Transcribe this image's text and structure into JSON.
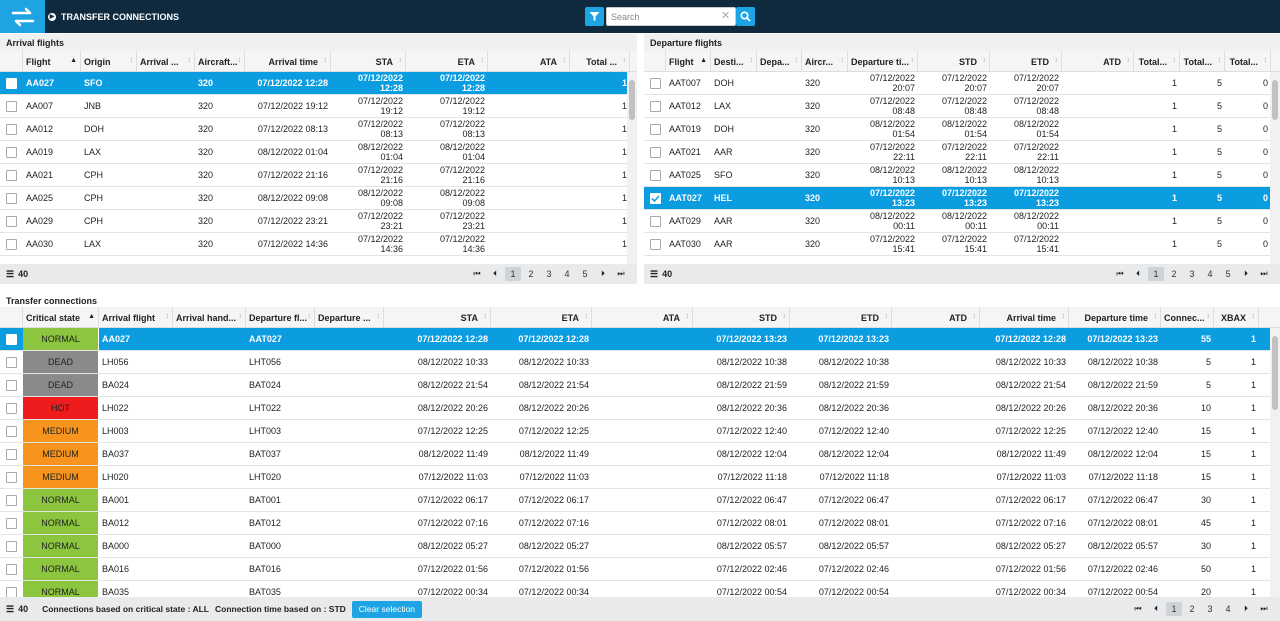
{
  "app": {
    "title": "TRANSFER CONNECTIONS",
    "search_placeholder": "Search",
    "search_value": "",
    "logo_icon": "swap-arrows-icon",
    "accent": "#0c9de1"
  },
  "arrivals": {
    "title": "Arrival flights",
    "columns": [
      "Flight",
      "Origin",
      "Arrival ...",
      "Aircraft...",
      "Arrival time",
      "STA",
      "ETA",
      "ATA",
      "Total ..."
    ],
    "rows": [
      {
        "selected": true,
        "flight": "AA027",
        "origin": "SFO",
        "handler": "",
        "aircraft": "320",
        "arrival": "07/12/2022 12:28",
        "sta": [
          "07/12/2022",
          "12:28"
        ],
        "eta": [
          "07/12/2022",
          "12:28"
        ],
        "ata": "",
        "total": "1"
      },
      {
        "selected": false,
        "flight": "AA007",
        "origin": "JNB",
        "handler": "",
        "aircraft": "320",
        "arrival": "07/12/2022 19:12",
        "sta": [
          "07/12/2022",
          "19:12"
        ],
        "eta": [
          "07/12/2022",
          "19:12"
        ],
        "ata": "",
        "total": "1"
      },
      {
        "selected": false,
        "flight": "AA012",
        "origin": "DOH",
        "handler": "",
        "aircraft": "320",
        "arrival": "07/12/2022 08:13",
        "sta": [
          "07/12/2022",
          "08:13"
        ],
        "eta": [
          "07/12/2022",
          "08:13"
        ],
        "ata": "",
        "total": "1"
      },
      {
        "selected": false,
        "flight": "AA019",
        "origin": "LAX",
        "handler": "",
        "aircraft": "320",
        "arrival": "08/12/2022 01:04",
        "sta": [
          "08/12/2022",
          "01:04"
        ],
        "eta": [
          "08/12/2022",
          "01:04"
        ],
        "ata": "",
        "total": "1"
      },
      {
        "selected": false,
        "flight": "AA021",
        "origin": "CPH",
        "handler": "",
        "aircraft": "320",
        "arrival": "07/12/2022 21:16",
        "sta": [
          "07/12/2022",
          "21:16"
        ],
        "eta": [
          "07/12/2022",
          "21:16"
        ],
        "ata": "",
        "total": "1"
      },
      {
        "selected": false,
        "flight": "AA025",
        "origin": "CPH",
        "handler": "",
        "aircraft": "320",
        "arrival": "08/12/2022 09:08",
        "sta": [
          "08/12/2022",
          "09:08"
        ],
        "eta": [
          "08/12/2022",
          "09:08"
        ],
        "ata": "",
        "total": "1"
      },
      {
        "selected": false,
        "flight": "AA029",
        "origin": "CPH",
        "handler": "",
        "aircraft": "320",
        "arrival": "07/12/2022 23:21",
        "sta": [
          "07/12/2022",
          "23:21"
        ],
        "eta": [
          "07/12/2022",
          "23:21"
        ],
        "ata": "",
        "total": "1"
      },
      {
        "selected": false,
        "flight": "AA030",
        "origin": "LAX",
        "handler": "",
        "aircraft": "320",
        "arrival": "07/12/2022 14:36",
        "sta": [
          "07/12/2022",
          "14:36"
        ],
        "eta": [
          "07/12/2022",
          "14:36"
        ],
        "ata": "",
        "total": "1"
      }
    ],
    "count": "40",
    "pages": [
      "1",
      "2",
      "3",
      "4",
      "5"
    ]
  },
  "departures": {
    "title": "Departure flights",
    "columns": [
      "Flight",
      "Desti...",
      "Depa...",
      "Aircr...",
      "Departure ti...",
      "STD",
      "ETD",
      "ATD",
      "Total...",
      "Total...",
      "Total..."
    ],
    "rows": [
      {
        "selected": false,
        "flight": "AAT007",
        "dest": "DOH",
        "handler": "",
        "aircraft": "320",
        "dep": [
          "07/12/2022",
          "20:07"
        ],
        "std": [
          "07/12/2022",
          "20:07"
        ],
        "etd": [
          "07/12/2022",
          "20:07"
        ],
        "atd": "",
        "t1": "1",
        "t2": "5",
        "t3": "0"
      },
      {
        "selected": false,
        "flight": "AAT012",
        "dest": "LAX",
        "handler": "",
        "aircraft": "320",
        "dep": [
          "07/12/2022",
          "08:48"
        ],
        "std": [
          "07/12/2022",
          "08:48"
        ],
        "etd": [
          "07/12/2022",
          "08:48"
        ],
        "atd": "",
        "t1": "1",
        "t2": "5",
        "t3": "0"
      },
      {
        "selected": false,
        "flight": "AAT019",
        "dest": "DOH",
        "handler": "",
        "aircraft": "320",
        "dep": [
          "08/12/2022",
          "01:54"
        ],
        "std": [
          "08/12/2022",
          "01:54"
        ],
        "etd": [
          "08/12/2022",
          "01:54"
        ],
        "atd": "",
        "t1": "1",
        "t2": "5",
        "t3": "0"
      },
      {
        "selected": false,
        "flight": "AAT021",
        "dest": "AAR",
        "handler": "",
        "aircraft": "320",
        "dep": [
          "07/12/2022",
          "22:11"
        ],
        "std": [
          "07/12/2022",
          "22:11"
        ],
        "etd": [
          "07/12/2022",
          "22:11"
        ],
        "atd": "",
        "t1": "1",
        "t2": "5",
        "t3": "0"
      },
      {
        "selected": false,
        "flight": "AAT025",
        "dest": "SFO",
        "handler": "",
        "aircraft": "320",
        "dep": [
          "08/12/2022",
          "10:13"
        ],
        "std": [
          "08/12/2022",
          "10:13"
        ],
        "etd": [
          "08/12/2022",
          "10:13"
        ],
        "atd": "",
        "t1": "1",
        "t2": "5",
        "t3": "0"
      },
      {
        "selected": true,
        "flight": "AAT027",
        "dest": "HEL",
        "handler": "",
        "aircraft": "320",
        "dep": [
          "07/12/2022",
          "13:23"
        ],
        "std": [
          "07/12/2022",
          "13:23"
        ],
        "etd": [
          "07/12/2022",
          "13:23"
        ],
        "atd": "",
        "t1": "1",
        "t2": "5",
        "t3": "0"
      },
      {
        "selected": false,
        "flight": "AAT029",
        "dest": "AAR",
        "handler": "",
        "aircraft": "320",
        "dep": [
          "08/12/2022",
          "00:11"
        ],
        "std": [
          "08/12/2022",
          "00:11"
        ],
        "etd": [
          "08/12/2022",
          "00:11"
        ],
        "atd": "",
        "t1": "1",
        "t2": "5",
        "t3": "0"
      },
      {
        "selected": false,
        "flight": "AAT030",
        "dest": "AAR",
        "handler": "",
        "aircraft": "320",
        "dep": [
          "07/12/2022",
          "15:41"
        ],
        "std": [
          "07/12/2022",
          "15:41"
        ],
        "etd": [
          "07/12/2022",
          "15:41"
        ],
        "atd": "",
        "t1": "1",
        "t2": "5",
        "t3": "0"
      }
    ],
    "count": "40",
    "pages": [
      "1",
      "2",
      "3",
      "4",
      "5"
    ]
  },
  "transfers": {
    "title": "Transfer connections",
    "columns": [
      "Critical state",
      "Arrival flight",
      "Arrival hand...",
      "Departure fl...",
      "Departure ...",
      "STA",
      "ETA",
      "ATA",
      "STD",
      "ETD",
      "ATD",
      "Arrival time",
      "Departure time",
      "Connec...",
      "XBAX"
    ],
    "state_colors": {
      "NORMAL": "#8cc63f",
      "DEAD": "#8a8a8a",
      "HOT": "#ee1c1c",
      "MEDIUM": "#f7941d"
    },
    "rows": [
      {
        "selected": true,
        "state": "NORMAL",
        "arr": "AA027",
        "arrh": "",
        "dep": "AAT027",
        "deph": "",
        "sta": "07/12/2022 12:28",
        "eta": "07/12/2022 12:28",
        "ata": "",
        "std": "07/12/2022 13:23",
        "etd": "07/12/2022 13:23",
        "atd": "",
        "arrt": "07/12/2022 12:28",
        "dept": "07/12/2022 13:23",
        "conn": "55",
        "xbax": "1"
      },
      {
        "selected": false,
        "state": "DEAD",
        "arr": "LH056",
        "arrh": "",
        "dep": "LHT056",
        "deph": "",
        "sta": "08/12/2022 10:33",
        "eta": "08/12/2022 10:33",
        "ata": "",
        "std": "08/12/2022 10:38",
        "etd": "08/12/2022 10:38",
        "atd": "",
        "arrt": "08/12/2022 10:33",
        "dept": "08/12/2022 10:38",
        "conn": "5",
        "xbax": "1"
      },
      {
        "selected": false,
        "state": "DEAD",
        "arr": "BA024",
        "arrh": "",
        "dep": "BAT024",
        "deph": "",
        "sta": "08/12/2022 21:54",
        "eta": "08/12/2022 21:54",
        "ata": "",
        "std": "08/12/2022 21:59",
        "etd": "08/12/2022 21:59",
        "atd": "",
        "arrt": "08/12/2022 21:54",
        "dept": "08/12/2022 21:59",
        "conn": "5",
        "xbax": "1"
      },
      {
        "selected": false,
        "state": "HOT",
        "arr": "LH022",
        "arrh": "",
        "dep": "LHT022",
        "deph": "",
        "sta": "08/12/2022 20:26",
        "eta": "08/12/2022 20:26",
        "ata": "",
        "std": "08/12/2022 20:36",
        "etd": "08/12/2022 20:36",
        "atd": "",
        "arrt": "08/12/2022 20:26",
        "dept": "08/12/2022 20:36",
        "conn": "10",
        "xbax": "1"
      },
      {
        "selected": false,
        "state": "MEDIUM",
        "arr": "LH003",
        "arrh": "",
        "dep": "LHT003",
        "deph": "",
        "sta": "07/12/2022 12:25",
        "eta": "07/12/2022 12:25",
        "ata": "",
        "std": "07/12/2022 12:40",
        "etd": "07/12/2022 12:40",
        "atd": "",
        "arrt": "07/12/2022 12:25",
        "dept": "07/12/2022 12:40",
        "conn": "15",
        "xbax": "1"
      },
      {
        "selected": false,
        "state": "MEDIUM",
        "arr": "BA037",
        "arrh": "",
        "dep": "BAT037",
        "deph": "",
        "sta": "08/12/2022 11:49",
        "eta": "08/12/2022 11:49",
        "ata": "",
        "std": "08/12/2022 12:04",
        "etd": "08/12/2022 12:04",
        "atd": "",
        "arrt": "08/12/2022 11:49",
        "dept": "08/12/2022 12:04",
        "conn": "15",
        "xbax": "1"
      },
      {
        "selected": false,
        "state": "MEDIUM",
        "arr": "LH020",
        "arrh": "",
        "dep": "LHT020",
        "deph": "",
        "sta": "07/12/2022 11:03",
        "eta": "07/12/2022 11:03",
        "ata": "",
        "std": "07/12/2022 11:18",
        "etd": "07/12/2022 11:18",
        "atd": "",
        "arrt": "07/12/2022 11:03",
        "dept": "07/12/2022 11:18",
        "conn": "15",
        "xbax": "1"
      },
      {
        "selected": false,
        "state": "NORMAL",
        "arr": "BA001",
        "arrh": "",
        "dep": "BAT001",
        "deph": "",
        "sta": "07/12/2022 06:17",
        "eta": "07/12/2022 06:17",
        "ata": "",
        "std": "07/12/2022 06:47",
        "etd": "07/12/2022 06:47",
        "atd": "",
        "arrt": "07/12/2022 06:17",
        "dept": "07/12/2022 06:47",
        "conn": "30",
        "xbax": "1"
      },
      {
        "selected": false,
        "state": "NORMAL",
        "arr": "BA012",
        "arrh": "",
        "dep": "BAT012",
        "deph": "",
        "sta": "07/12/2022 07:16",
        "eta": "07/12/2022 07:16",
        "ata": "",
        "std": "07/12/2022 08:01",
        "etd": "07/12/2022 08:01",
        "atd": "",
        "arrt": "07/12/2022 07:16",
        "dept": "07/12/2022 08:01",
        "conn": "45",
        "xbax": "1"
      },
      {
        "selected": false,
        "state": "NORMAL",
        "arr": "BA000",
        "arrh": "",
        "dep": "BAT000",
        "deph": "",
        "sta": "08/12/2022 05:27",
        "eta": "08/12/2022 05:27",
        "ata": "",
        "std": "08/12/2022 05:57",
        "etd": "08/12/2022 05:57",
        "atd": "",
        "arrt": "08/12/2022 05:27",
        "dept": "08/12/2022 05:57",
        "conn": "30",
        "xbax": "1"
      },
      {
        "selected": false,
        "state": "NORMAL",
        "arr": "BA016",
        "arrh": "",
        "dep": "BAT016",
        "deph": "",
        "sta": "07/12/2022 01:56",
        "eta": "07/12/2022 01:56",
        "ata": "",
        "std": "07/12/2022 02:46",
        "etd": "07/12/2022 02:46",
        "atd": "",
        "arrt": "07/12/2022 01:56",
        "dept": "07/12/2022 02:46",
        "conn": "50",
        "xbax": "1"
      },
      {
        "selected": false,
        "state": "NORMAL",
        "arr": "BA035",
        "arrh": "",
        "dep": "BAT035",
        "deph": "",
        "sta": "07/12/2022 00:34",
        "eta": "07/12/2022 00:34",
        "ata": "",
        "std": "07/12/2022 00:54",
        "etd": "07/12/2022 00:54",
        "atd": "",
        "arrt": "07/12/2022 00:34",
        "dept": "07/12/2022 00:54",
        "conn": "20",
        "xbax": "1"
      }
    ],
    "count": "40",
    "footer_state": "Connections based on critical state : ALL",
    "footer_time": "Connection time based on : STD",
    "clear_label": "Clear selection",
    "pages": [
      "1",
      "2",
      "3",
      "4"
    ]
  }
}
